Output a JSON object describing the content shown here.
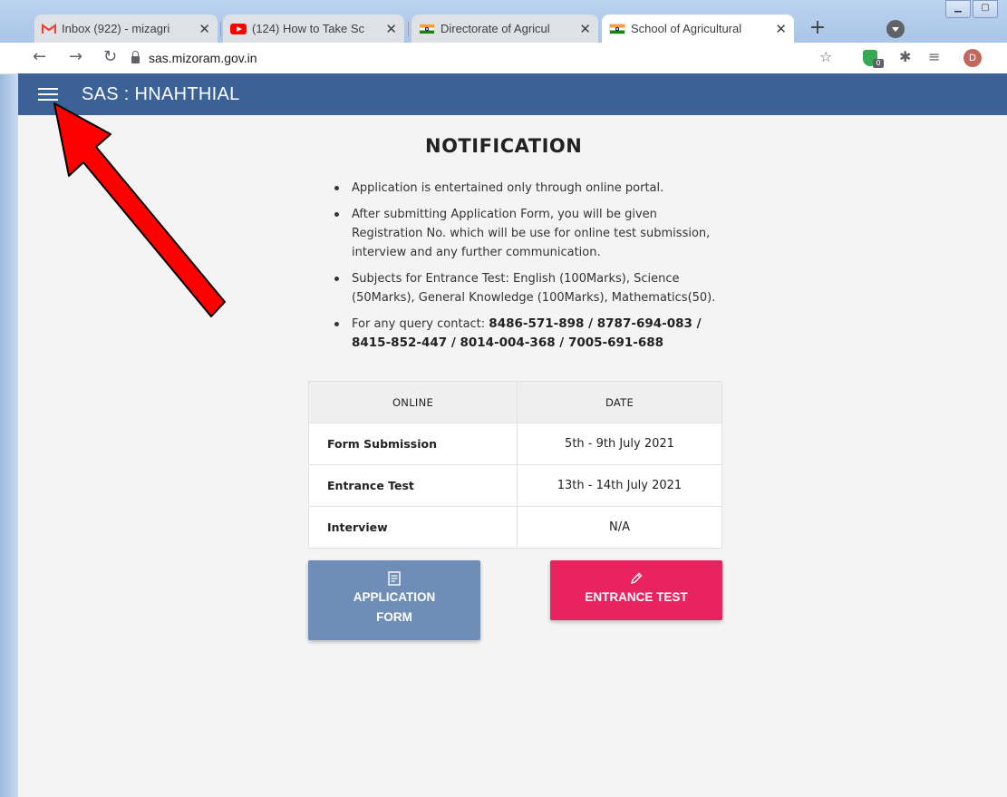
{
  "browser": {
    "tabs": [
      {
        "title": "Inbox (922) - mizagri",
        "favicon": "gmail-icon",
        "active": false
      },
      {
        "title": "(124) How to Take Sc",
        "favicon": "youtube-icon",
        "active": false
      },
      {
        "title": "Directorate of Agricul",
        "favicon": "india-flag-icon",
        "active": false
      },
      {
        "title": "School of Agricultural",
        "favicon": "india-flag-icon",
        "active": true
      }
    ],
    "url": "sas.mizoram.gov.in",
    "extension_badge": "0",
    "profile_initial": "D"
  },
  "app": {
    "title": "SAS : HNAHTHIAL",
    "bar_color": "#3b6197"
  },
  "notification": {
    "heading": "NOTIFICATION",
    "items": [
      "Application is entertained only through online portal.",
      "After submitting Application Form, you will be given Registration No. which will be use for online test submission, interview and any further communication.",
      "Subjects for Entrance Test: English (100Marks), Science (50Marks), General Knowledge (100Marks), Mathematics(50)."
    ],
    "contact_prefix": "For any query contact: ",
    "contact_numbers": "8486-571-898 / 8787-694-083 / 8415-852-447 / 8014-004-368 / 7005-691-688"
  },
  "schedule": {
    "headers": [
      "ONLINE",
      "DATE"
    ],
    "rows": [
      {
        "label": "Form Submission",
        "date": "5th - 9th July 2021"
      },
      {
        "label": "Entrance Test",
        "date": "13th - 14th July 2021"
      },
      {
        "label": "Interview",
        "date": "N/A"
      }
    ]
  },
  "buttons": {
    "application_form": {
      "line1": "APPLICATION",
      "line2": "FORM",
      "color": "#6f8eb7"
    },
    "entrance_test": {
      "label": "ENTRANCE TEST",
      "color": "#e8235f"
    }
  },
  "annotation": {
    "arrow_color": "#ff0000"
  }
}
